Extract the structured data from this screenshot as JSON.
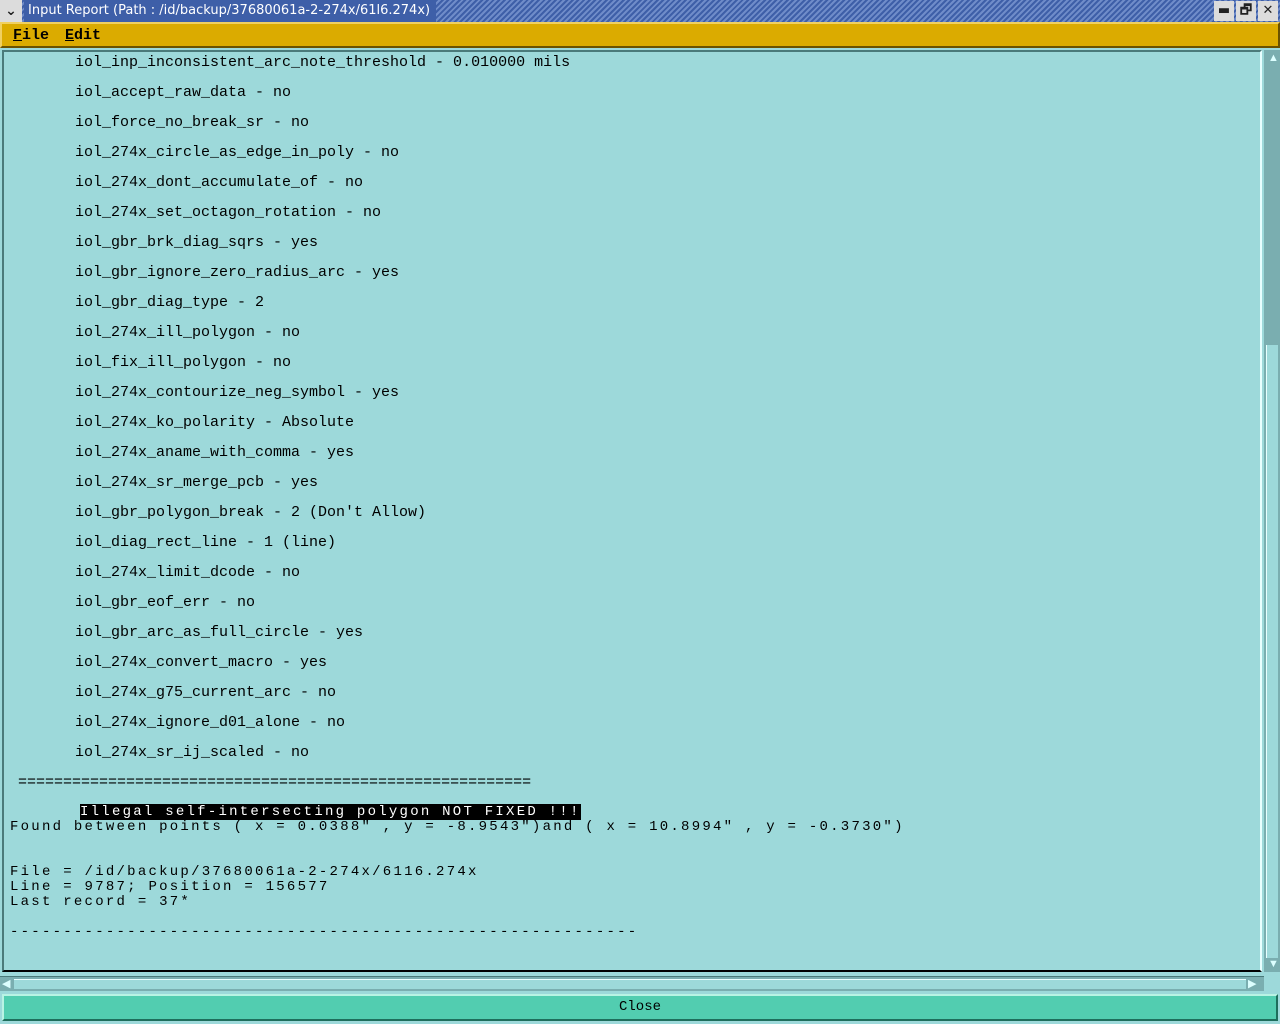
{
  "window": {
    "title": "Input Report (Path : /id/backup/37680061a-2-274x/61l6.274x)",
    "menu_glyph": "⌄",
    "minimize": "▬",
    "maximize": "🗗",
    "close": "✕"
  },
  "menu": {
    "file": "ile",
    "file_key": "F",
    "edit": "dit",
    "edit_key": "E"
  },
  "settings": [
    "iol_inp_inconsistent_arc_note_threshold - 0.010000 mils",
    "iol_accept_raw_data - no",
    "iol_force_no_break_sr - no",
    "iol_274x_circle_as_edge_in_poly - no",
    "iol_274x_dont_accumulate_of - no",
    "iol_274x_set_octagon_rotation - no",
    "iol_gbr_brk_diag_sqrs - yes",
    "iol_gbr_ignore_zero_radius_arc - yes",
    "iol_gbr_diag_type - 2",
    "iol_274x_ill_polygon - no",
    "iol_fix_ill_polygon - no",
    "iol_274x_contourize_neg_symbol - yes",
    "iol_274x_ko_polarity - Absolute",
    "iol_274x_aname_with_comma - yes",
    "iol_274x_sr_merge_pcb - yes",
    "iol_gbr_polygon_break - 2 (Don't Allow)",
    "iol_diag_rect_line - 1 (line)",
    "iol_274x_limit_dcode - no",
    "iol_gbr_eof_err - no",
    "iol_gbr_arc_as_full_circle - yes",
    "iol_274x_convert_macro - yes",
    "iol_274x_g75_current_arc - no",
    "iol_274x_ignore_d01_alone - no",
    "iol_274x_sr_ij_scaled - no"
  ],
  "separator": "=========================================================",
  "error": {
    "message": "Illegal self-intersecting polygon NOT FIXED !!!",
    "found": "Found between points ( x = 0.0388\" , y = -8.9543\")and ( x = 10.8994\" , y = -0.3730\")",
    "file": "File = /id/backup/37680061a-2-274x/6116.274x",
    "line": "Line = 9787; Position = 156577",
    "last_record": "Last record = 37*"
  },
  "dashes": "-----------------------------------------------------------",
  "buttons": {
    "close": "Close"
  }
}
